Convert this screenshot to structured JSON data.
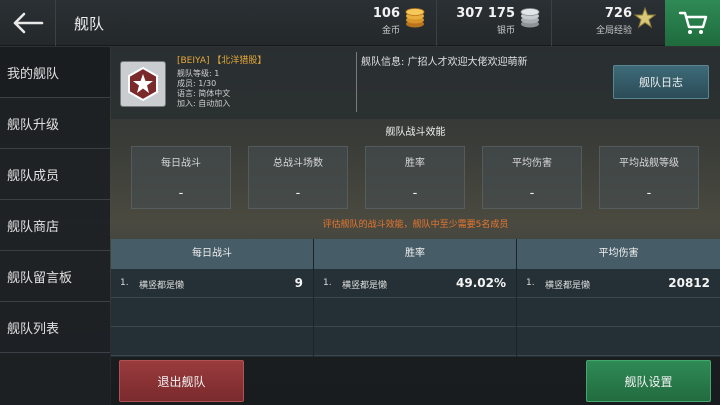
{
  "header": {
    "title": "舰队",
    "gold": {
      "value": "106",
      "label": "金币"
    },
    "silver": {
      "value": "307 175",
      "label": "银币"
    },
    "xp": {
      "value": "726",
      "label": "全局经验"
    }
  },
  "sidebar": {
    "items": [
      {
        "label": "我的舰队",
        "active": true
      },
      {
        "label": "舰队升级"
      },
      {
        "label": "舰队成员"
      },
      {
        "label": "舰队商店"
      },
      {
        "label": "舰队留言板"
      },
      {
        "label": "舰队列表"
      }
    ]
  },
  "fleet": {
    "name": "[BEIYA] 【北洋猎股】",
    "level": "舰队等级: 1",
    "members": "成员: 1/30",
    "language": "语言: 简体中文",
    "join": "加入: 自动加入",
    "message": "舰队信息: 广招人才欢迎大佬欢迎萌新",
    "log_button": "舰队日志"
  },
  "efficiency": {
    "title": "舰队战斗效能",
    "cards": [
      {
        "label": "每日战斗",
        "value": "-"
      },
      {
        "label": "总战斗场数",
        "value": "-"
      },
      {
        "label": "胜率",
        "value": "-"
      },
      {
        "label": "平均伤害",
        "value": "-"
      },
      {
        "label": "平均战舰等级",
        "value": "-"
      }
    ],
    "warning": "评估舰队的战斗效能，舰队中至少需要5名成员"
  },
  "leaderboard": {
    "columns": [
      {
        "header": "每日战斗",
        "rank": "1.",
        "name": "横竖都是懒",
        "value": "9"
      },
      {
        "header": "胜率",
        "rank": "1.",
        "name": "横竖都是懒",
        "value": "49.02%"
      },
      {
        "header": "平均伤害",
        "rank": "1.",
        "name": "横竖都是懒",
        "value": "20812"
      }
    ]
  },
  "footer": {
    "leave_button": "退出舰队",
    "settings_button": "舰队设置"
  },
  "colors": {
    "accent_green": "#2f8a55",
    "danger_red": "#9a3b3d",
    "warning_orange": "#e8762e",
    "fleet_name_gold": "#e6a93a"
  },
  "icons": [
    "back-arrow-icon",
    "gold-coin-icon",
    "silver-coin-icon",
    "xp-star-icon",
    "cart-icon",
    "fleet-emblem-icon"
  ]
}
